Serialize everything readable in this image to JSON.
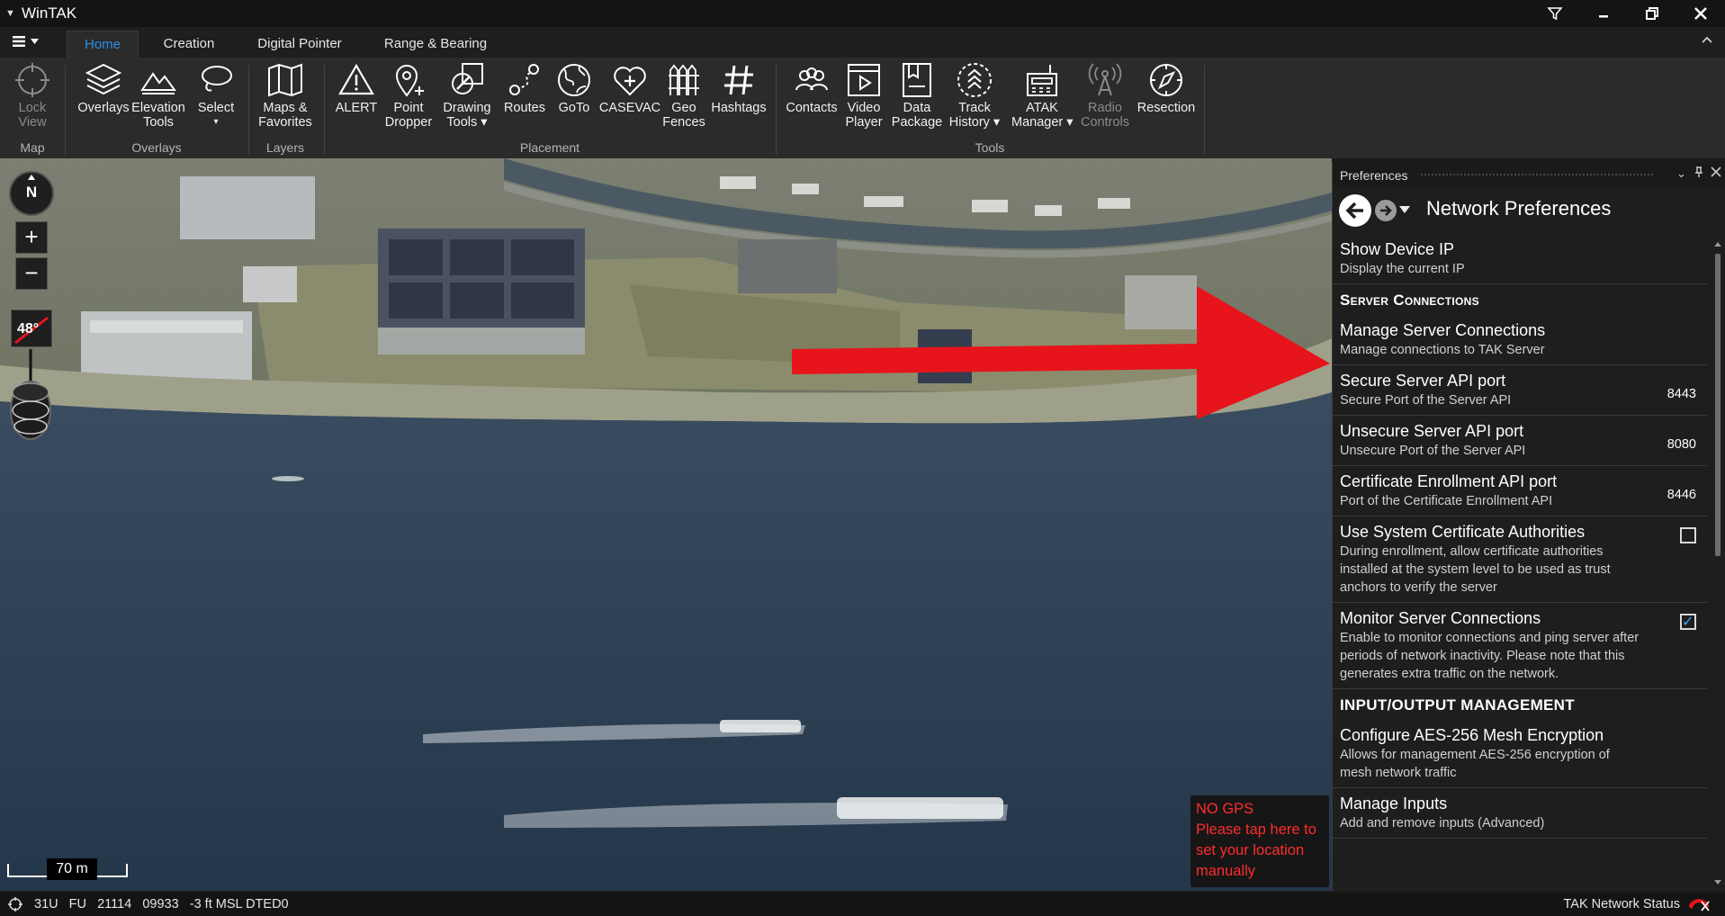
{
  "app": {
    "title": "WinTAK"
  },
  "tabs": [
    {
      "label": "Home",
      "active": true
    },
    {
      "label": "Creation",
      "active": false
    },
    {
      "label": "Digital Pointer",
      "active": false
    },
    {
      "label": "Range & Bearing",
      "active": false
    }
  ],
  "ribbon": {
    "lock_view": {
      "line1": "Lock",
      "line2": "View"
    },
    "overlays": {
      "line1": "Overlays"
    },
    "elevation_tools": {
      "line1": "Elevation",
      "line2": "Tools"
    },
    "select": {
      "line1": "Select",
      "line2": "▾"
    },
    "maps_favorites": {
      "line1": "Maps &",
      "line2": "Favorites"
    },
    "alert": {
      "line1": "ALERT"
    },
    "point_dropper": {
      "line1": "Point",
      "line2": "Dropper"
    },
    "drawing_tools": {
      "line1": "Drawing",
      "line2": "Tools ▾"
    },
    "routes": {
      "line1": "Routes"
    },
    "goto": {
      "line1": "GoTo"
    },
    "casevac": {
      "line1": "CASEVAC"
    },
    "geo_fences": {
      "line1": "Geo",
      "line2": "Fences"
    },
    "hashtags": {
      "line1": "Hashtags"
    },
    "contacts": {
      "line1": "Contacts"
    },
    "video_player": {
      "line1": "Video",
      "line2": "Player"
    },
    "data_package": {
      "line1": "Data",
      "line2": "Package"
    },
    "track_history": {
      "line1": "Track",
      "line2": "History ▾"
    },
    "atak_manager": {
      "line1": "ATAK",
      "line2": "Manager ▾"
    },
    "radio_controls": {
      "line1": "Radio",
      "line2": "Controls"
    },
    "resection": {
      "line1": "Resection"
    },
    "groups": {
      "map": "Map",
      "overlays": "Overlays",
      "layers": "Layers",
      "placement": "Placement",
      "tools": "Tools"
    }
  },
  "map": {
    "tilt_label": "48°",
    "compass_label": "N",
    "zoom_in": "+",
    "zoom_out": "−",
    "scale_label": "70 m",
    "nogps": {
      "line1": "NO GPS",
      "line2": "Please tap here to",
      "line3": "set your location",
      "line4": "manually"
    }
  },
  "prefs": {
    "header": "Preferences",
    "page_title": "Network Preferences",
    "items": [
      {
        "title": "Show Device IP",
        "sub": "Display the current IP"
      },
      {
        "section": "Server Connections"
      },
      {
        "title": "Manage Server Connections",
        "sub": "Manage connections to TAK Server"
      },
      {
        "title": "Secure Server API port",
        "sub": "Secure Port of the Server API",
        "value": "8443"
      },
      {
        "title": "Unsecure Server API port",
        "sub": "Unsecure Port of the Server API",
        "value": "8080"
      },
      {
        "title": "Certificate Enrollment API port",
        "sub": "Port of the Certificate Enrollment API",
        "value": "8446"
      },
      {
        "title": "Use System Certificate Authorities",
        "sub": "During enrollment, allow certificate authorities installed at the system level to be used as trust anchors to verify the server",
        "checked": false
      },
      {
        "title": "Monitor Server Connections",
        "sub": "Enable to monitor connections and ping server after periods of network inactivity. Please note that this generates extra traffic on the network.",
        "checked": true
      },
      {
        "section": "INPUT/OUTPUT MANAGEMENT"
      },
      {
        "title": "Configure AES-256 Mesh Encryption",
        "sub": "Allows for management AES-256 encryption of mesh network traffic"
      },
      {
        "title": "Manage Inputs",
        "sub": "Add and remove inputs (Advanced)"
      }
    ]
  },
  "status": {
    "coords": "31U   FU   21114   09933   -3 ft MSL DTED0",
    "network": "TAK Network Status"
  },
  "colors": {
    "accent": "#2a8fe6",
    "alert_red": "#ff2b2b",
    "annotation_arrow": "#e8141b"
  }
}
